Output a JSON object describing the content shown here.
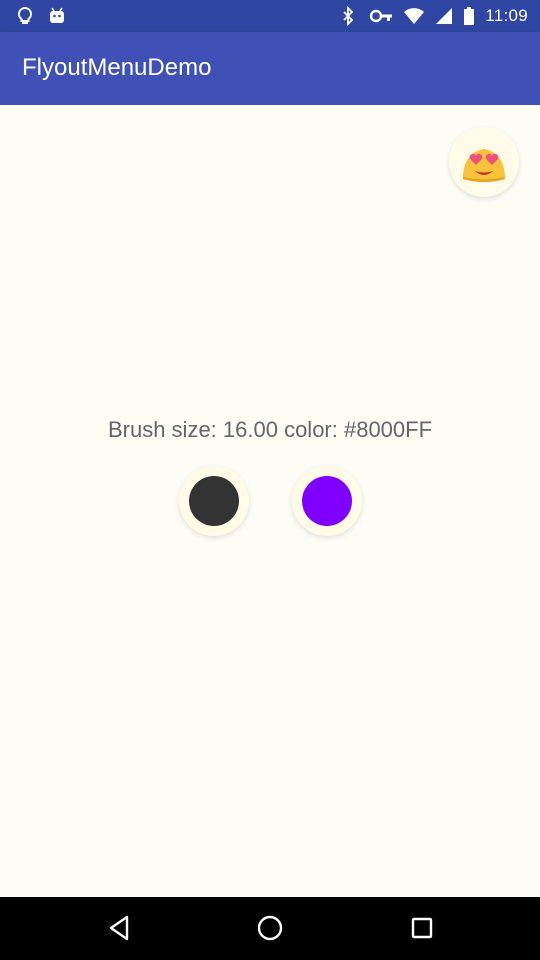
{
  "status_bar": {
    "time": "11:09",
    "left_icons": [
      "lightbulb-icon",
      "android-icon"
    ],
    "right_icons": [
      "bluetooth-icon",
      "vpn-key-icon",
      "wifi-icon",
      "signal-icon",
      "battery-icon"
    ]
  },
  "app_bar": {
    "title": "FlyoutMenuDemo",
    "color": "#3f51b5"
  },
  "content": {
    "emoji_button_icon": "smiling-heart-eyes-emoji-icon",
    "status_text": "Brush size: 16.00 color: #8000FF",
    "brush_size_color": "#333333",
    "brush_color": "#8000ff"
  },
  "nav_bar": {
    "buttons": [
      "back-icon",
      "home-icon",
      "recents-icon"
    ]
  }
}
